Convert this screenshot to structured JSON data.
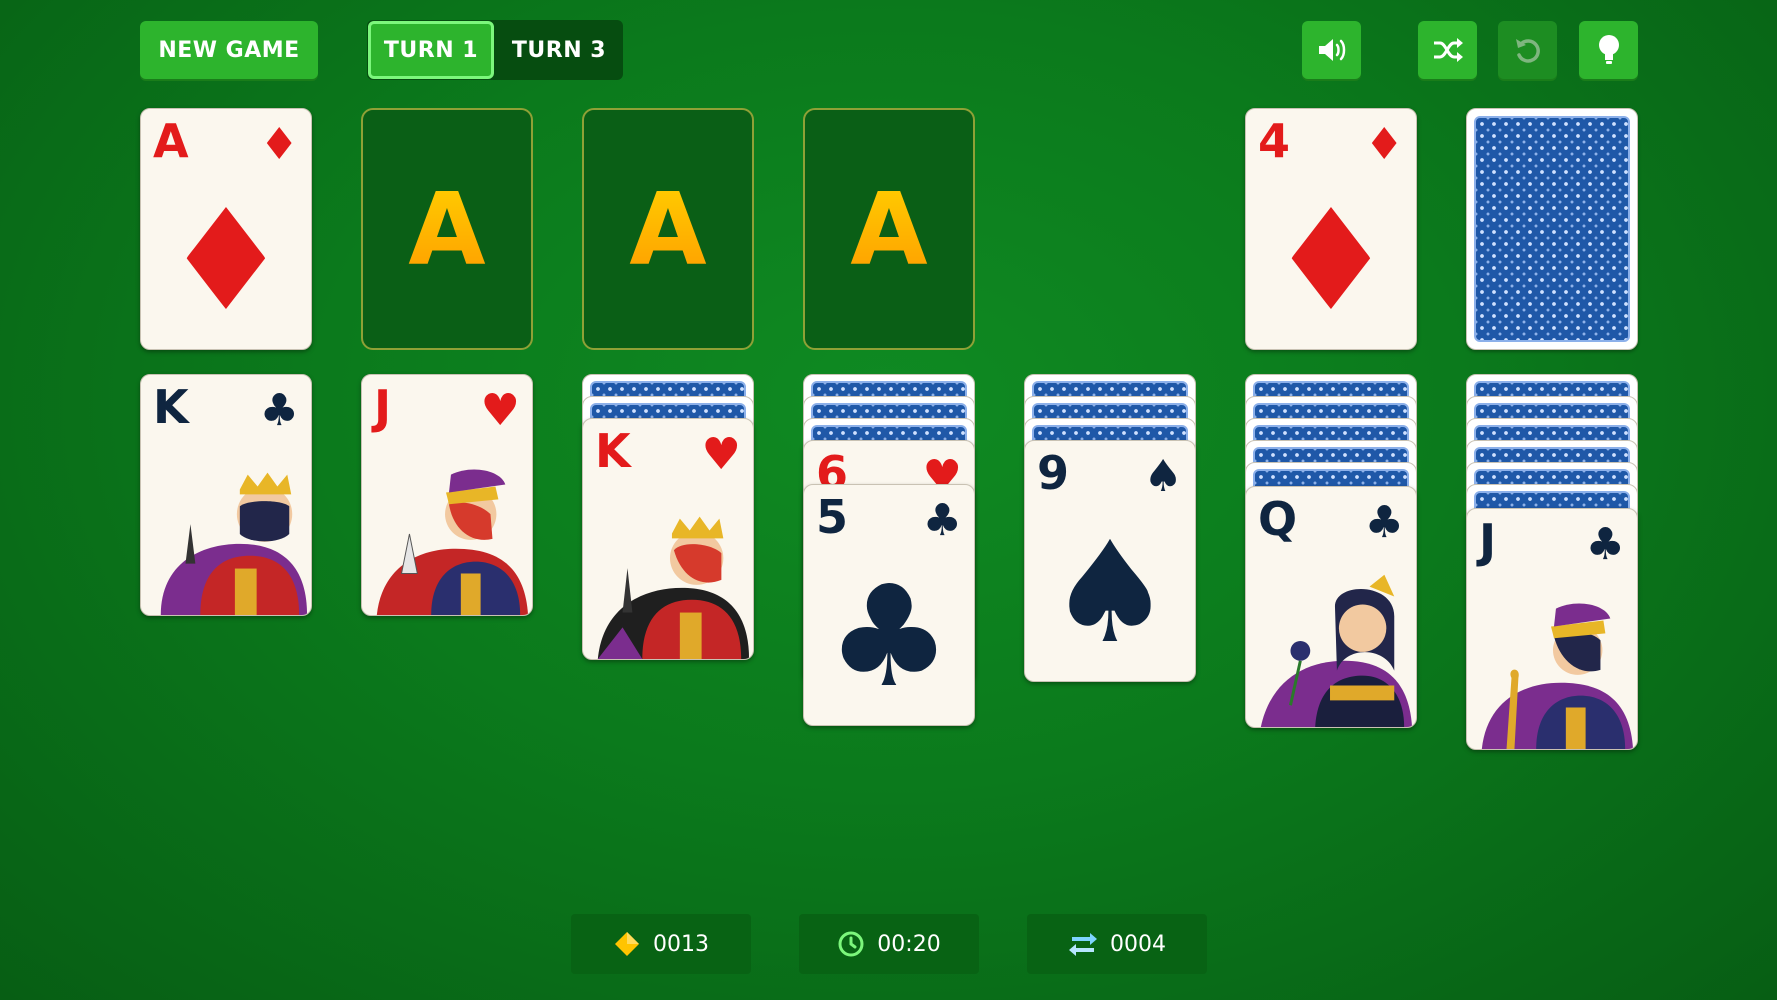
{
  "toolbar": {
    "new_game_label": "NEW GAME",
    "turn1_label": "TURN 1",
    "turn3_label": "TURN 3",
    "selected_mode": "TURN 1",
    "sound_icon": "speaker-icon",
    "shuffle_icon": "shuffle-icon",
    "undo_icon": "undo-icon",
    "hint_icon": "lightbulb-icon"
  },
  "foundations": [
    {
      "rank": "A",
      "suit": "♦",
      "color": "red"
    },
    {
      "placeholder": "A"
    },
    {
      "placeholder": "A"
    },
    {
      "placeholder": "A"
    }
  ],
  "waste": {
    "rank": "4",
    "suit": "♦",
    "color": "red"
  },
  "stock": {
    "face": "down"
  },
  "tableau": [
    {
      "hidden": 0,
      "cards": [
        {
          "rank": "K",
          "suit": "♣"
        }
      ]
    },
    {
      "hidden": 0,
      "cards": [
        {
          "rank": "J",
          "suit": "♥"
        }
      ]
    },
    {
      "hidden": 2,
      "cards": [
        {
          "rank": "K",
          "suit": "♥"
        }
      ]
    },
    {
      "hidden": 3,
      "cards": [
        {
          "rank": "6",
          "suit": "♥"
        },
        {
          "rank": "5",
          "suit": "♣"
        }
      ]
    },
    {
      "hidden": 3,
      "cards": [
        {
          "rank": "9",
          "suit": "♠"
        }
      ]
    },
    {
      "hidden": 5,
      "cards": [
        {
          "rank": "Q",
          "suit": "♣"
        }
      ]
    },
    {
      "hidden": 6,
      "cards": [
        {
          "rank": "J",
          "suit": "♣"
        }
      ]
    }
  ],
  "stats": {
    "score": "0013",
    "time": "00:20",
    "moves": "0004"
  },
  "colors": {
    "felt": "#0b7a1c",
    "button": "#2db42d",
    "red_suit": "#e31b1b",
    "black_suit": "#0f2540",
    "card_back": "#1f58a8",
    "placeholder_a": "#ffc000"
  }
}
